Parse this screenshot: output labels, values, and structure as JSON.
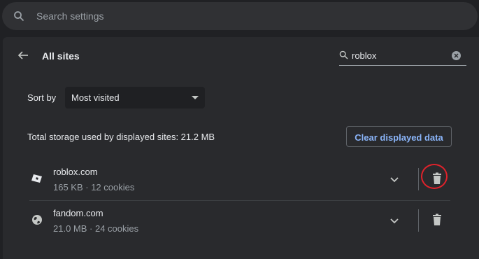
{
  "search": {
    "placeholder": "Search settings"
  },
  "page": {
    "title": "All sites"
  },
  "filter": {
    "value": "roblox"
  },
  "sort": {
    "label": "Sort by",
    "selected": "Most visited"
  },
  "storage": {
    "summary": "Total storage used by displayed sites: 21.2 MB",
    "clear_label": "Clear displayed data"
  },
  "sites": [
    {
      "domain": "roblox.com",
      "details": "165 KB · 12 cookies",
      "icon": "roblox-favicon"
    },
    {
      "domain": "fandom.com",
      "details": "21.0 MB · 24 cookies",
      "icon": "globe-icon"
    }
  ],
  "colors": {
    "accent": "#8ab4f8",
    "highlight": "#e0222b"
  }
}
